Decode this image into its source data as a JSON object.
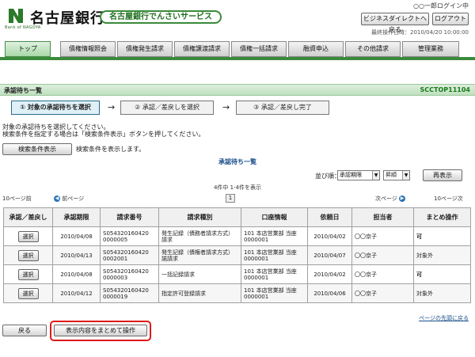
{
  "header": {
    "bank_name": "名古屋銀行",
    "logo_sub": "Bank of NAGOYA",
    "service_name": "名古屋銀行でんさいサービス",
    "user_line": "○○一郎ログイン中",
    "direct_button": "ビジネスダイレクトへ戻る",
    "logout_button": "ログアウト",
    "last_operation": "最終操作日時：2010/04/20 10:00:00",
    "brand_color": "#3a8a3a"
  },
  "tabs": [
    "トップ",
    "債権情報照会",
    "債権発生請求",
    "債権譲渡請求",
    "債権一括請求",
    "融資申込",
    "その他請求",
    "管理業務"
  ],
  "title_bar": {
    "title": "承認待ち一覧",
    "screen_id": "SCCTOP11104"
  },
  "steps": [
    "① 対象の承認待ちを選択",
    "② 承認／差戻しを選択",
    "③ 承認／差戻し完了"
  ],
  "step_arrow": "→",
  "instructions": {
    "line1": "対象の承認待ちを選択してください。",
    "line2": "検索条件を指定する場合は「検索条件表示」ボタンを押してください。",
    "search_button": "検索条件表示",
    "search_note": "検索条件を表示します。"
  },
  "list_title": "承認待ち一覧",
  "sort": {
    "label": "並び順：",
    "field": "承認期限",
    "order": "昇順",
    "redisplay_button": "再表示"
  },
  "paging": {
    "count_text": "4件中 1-4件を表示",
    "prev10": "10ページ前",
    "prev": "前ページ",
    "page": "1",
    "next": "次ページ",
    "next10": "10ページ次"
  },
  "table": {
    "headers": [
      "承認／差戻し",
      "承認期限",
      "請求番号",
      "請求種別",
      "口座情報",
      "依頼日",
      "担当者",
      "まとめ操作"
    ],
    "select_label": "選択",
    "rows": [
      {
        "deadline": "2010/04/08",
        "req_no_1": "S054320160420",
        "req_no_2": "0000005",
        "type_1": "発生記録（債務者請求方式）",
        "type_2": "請求",
        "account_1": "101 本店営業部 当座",
        "account_2": "0000001",
        "request_date": "2010/04/02",
        "person": "〇〇京子",
        "batch": "可"
      },
      {
        "deadline": "2010/04/13",
        "req_no_1": "S054320160420",
        "req_no_2": "0002001",
        "type_1": "発生記録（債権者請求方式）",
        "type_2": "諾請求",
        "account_1": "101 本店営業部 当座",
        "account_2": "0000001",
        "request_date": "2010/04/07",
        "person": "〇〇京子",
        "batch": "対象外"
      },
      {
        "deadline": "2010/04/08",
        "req_no_1": "S054320160420",
        "req_no_2": "0000003",
        "type_1": "一括記録請求",
        "type_2": "",
        "account_1": "101 本店営業部 当座",
        "account_2": "0000001",
        "request_date": "2010/04/02",
        "person": "〇〇京子",
        "batch": "可"
      },
      {
        "deadline": "2010/04/12",
        "req_no_1": "S054320160420",
        "req_no_2": "0000019",
        "type_1": "指定許可登録請求",
        "type_2": "",
        "account_1": "101 本店営業部 当座",
        "account_2": "0000001",
        "request_date": "2010/04/06",
        "person": "〇〇京子",
        "batch": "対象外"
      }
    ]
  },
  "footer": {
    "to_top": "ページの先頭に戻る",
    "back_button": "戻る",
    "batch_button": "表示内容をまとめて操作"
  },
  "highlight_color": "#e01818"
}
